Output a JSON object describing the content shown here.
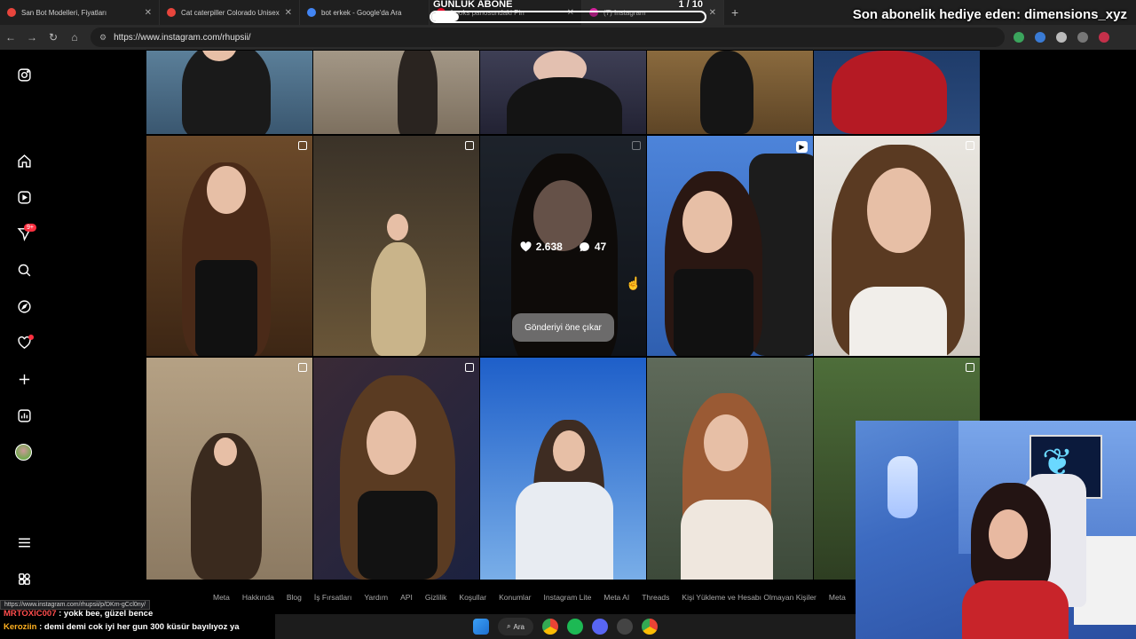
{
  "browser": {
    "tabs": [
      {
        "title": "San Bot Modelleri, Fiyatları",
        "favicon_color": "#e8453c"
      },
      {
        "title": "Cat caterpiller Colorado Unisex",
        "favicon_color": "#e8453c"
      },
      {
        "title": "bot erkek - Google'da Ara",
        "favicon_color": "#4285f4"
      },
      {
        "title": "Looks panosundaki Pin",
        "favicon_color": "#e60023"
      },
      {
        "title": "(7) Instagram",
        "favicon_color": "#d6249f"
      }
    ],
    "new_tab": "+",
    "url": "https://www.instagram.com/rhupsii/"
  },
  "overlay": {
    "goal_label": "GÜNLÜK ABONE",
    "goal_count": "1 / 10",
    "goal_progress": 0.1,
    "last_sub_gift": "Son abonelik hediye eden: dimensions_xyz"
  },
  "nav": {
    "notification_badge": "9+",
    "icons": [
      "instagram-icon",
      "home-icon",
      "reels-icon",
      "messages-icon",
      "search-icon",
      "explore-icon",
      "notifications-icon",
      "create-icon",
      "insights-icon",
      "profile-icon",
      "menu-icon",
      "meta-threads-icon"
    ]
  },
  "post_hover": {
    "likes": "2.638",
    "comments": "47",
    "pin_button": "Gönderiyi öne çıkar"
  },
  "footer": {
    "links": [
      "Meta",
      "Hakkında",
      "Blog",
      "İş Fırsatları",
      "Yardım",
      "API",
      "Gizlilik",
      "Koşullar",
      "Konumlar",
      "Instagram Lite",
      "Meta AI",
      "Threads",
      "Kişi Yükleme ve Hesabı Olmayan Kişiler",
      "Meta"
    ]
  },
  "status_url": "https://www.instagram.com/rhupsii/p/DKm-gCcl0ny/",
  "chat": [
    {
      "user": "MRTOXIC007",
      "message": " : yokk bee, güzel bence"
    },
    {
      "user": "Keroziin",
      "message": " : demi demi cok iyi her gun 300 küsür bayılıyoz ya"
    }
  ],
  "taskbar": {
    "search_label": "Ara"
  },
  "colors": {
    "accent": "#ff3040",
    "ig_bg": "#000000"
  }
}
